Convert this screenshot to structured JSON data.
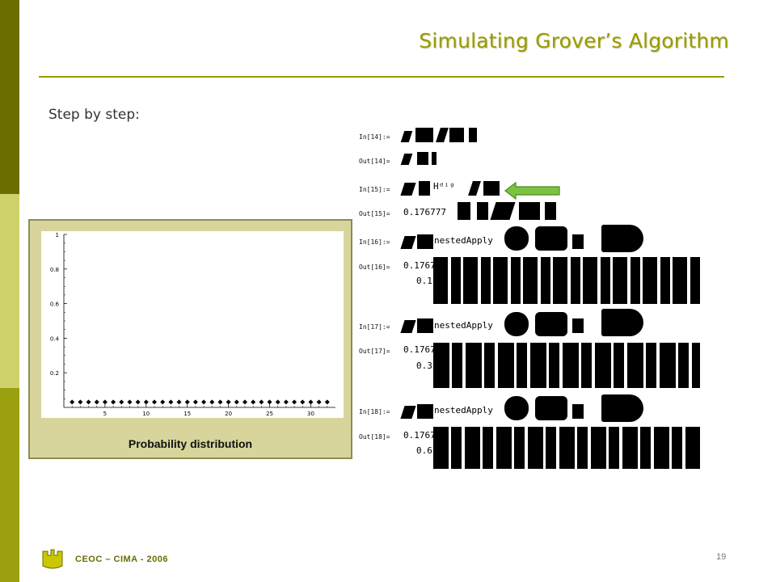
{
  "slide": {
    "title": "Simulating Grover’s Algorithm",
    "subtitle": "Step by step:",
    "footer": "CEOC – CIMA - 2006",
    "page_number": "19",
    "colors": {
      "accent": "#9a9a00",
      "bar_dark": "#6b6d00",
      "bar_light": "#cfd26a",
      "bar_mid": "#9aa00e",
      "arrow": "#7cc242"
    }
  },
  "plot": {
    "caption": "Probability distribution",
    "y_ticks": [
      "1",
      "0.8",
      "0.6",
      "0.4",
      "0.2"
    ],
    "x_ticks": [
      "5",
      "10",
      "15",
      "20",
      "25",
      "30"
    ]
  },
  "chart_data": {
    "type": "scatter",
    "x": [
      1,
      2,
      3,
      4,
      5,
      6,
      7,
      8,
      9,
      10,
      11,
      12,
      13,
      14,
      15,
      16,
      17,
      18,
      19,
      20,
      21,
      22,
      23,
      24,
      25,
      26,
      27,
      28,
      29,
      30,
      31,
      32
    ],
    "y": [
      0.03125,
      0.03125,
      0.03125,
      0.03125,
      0.03125,
      0.03125,
      0.03125,
      0.03125,
      0.03125,
      0.03125,
      0.03125,
      0.03125,
      0.03125,
      0.03125,
      0.03125,
      0.03125,
      0.03125,
      0.03125,
      0.03125,
      0.03125,
      0.03125,
      0.03125,
      0.03125,
      0.03125,
      0.03125,
      0.03125,
      0.03125,
      0.03125,
      0.03125,
      0.03125,
      0.03125,
      0.03125
    ],
    "xlim": [
      0,
      33
    ],
    "ylim": [
      0,
      1
    ],
    "grid": false
  },
  "notebook": {
    "labels": [
      "In[14]:=",
      "Out[14]=",
      "In[15]:=",
      "Out[15]=",
      "In[16]:=",
      "Out[16]=",
      "In[17]:=",
      "Out[17]=",
      "In[18]:=",
      "Out[18]="
    ],
    "fragments": {
      "in15": "Hᵈⁱᵍ",
      "out15": "0.176777",
      "in16": "nestedApply",
      "out16a": "0.1767",
      "out16b": "0.1",
      "in17": "nestedApply",
      "out17a": "0.1767",
      "out17b": "0.3",
      "in18": "nestedApply",
      "out18a": "0.1767",
      "out18b": "0.6"
    }
  }
}
